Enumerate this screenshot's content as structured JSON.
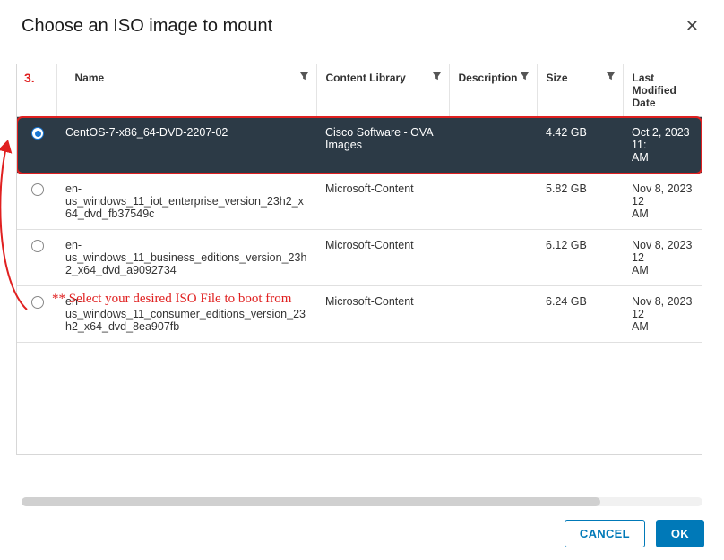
{
  "dialog": {
    "title": "Choose an ISO image to mount"
  },
  "annotation": {
    "step_num": "3.",
    "hint": "** Select your desired ISO File to boot from"
  },
  "table": {
    "headers": {
      "name": "Name",
      "content_library": "Content Library",
      "description": "Description",
      "size": "Size",
      "last_modified": "Last Modified Date"
    },
    "rows": [
      {
        "name": "CentOS-7-x86_64-DVD-2207-02",
        "content_library": "Cisco Software - OVA Images",
        "description": "",
        "size": "4.42 GB",
        "last_modified": "Oct 2, 2023 11:",
        "last_modified_line2": "AM",
        "selected": true
      },
      {
        "name": "en-us_windows_11_iot_enterprise_version_23h2_x64_dvd_fb37549c",
        "content_library": "Microsoft-Content",
        "description": "",
        "size": "5.82 GB",
        "last_modified": "Nov 8, 2023 12",
        "last_modified_line2": "AM",
        "selected": false
      },
      {
        "name": "en-us_windows_11_business_editions_version_23h2_x64_dvd_a9092734",
        "content_library": "Microsoft-Content",
        "description": "",
        "size": "6.12 GB",
        "last_modified": "Nov 8, 2023 12",
        "last_modified_line2": "AM",
        "selected": false
      },
      {
        "name": "en-us_windows_11_consumer_editions_version_23h2_x64_dvd_8ea907fb",
        "content_library": "Microsoft-Content",
        "description": "",
        "size": "6.24 GB",
        "last_modified": "Nov 8, 2023 12",
        "last_modified_line2": "AM",
        "selected": false
      }
    ]
  },
  "footer": {
    "cancel": "CANCEL",
    "ok": "OK"
  }
}
